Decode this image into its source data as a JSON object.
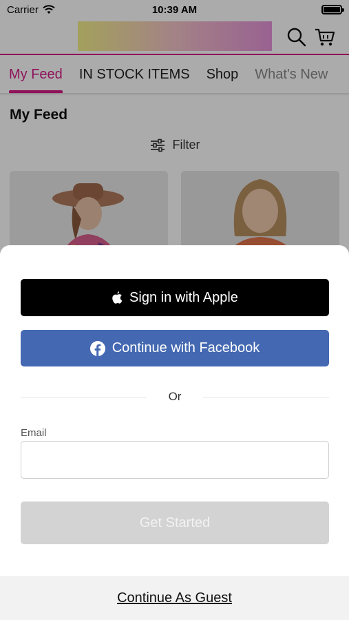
{
  "status_bar": {
    "carrier": "Carrier",
    "time": "10:39 AM"
  },
  "header": {
    "brand_colors": [
      "#f4f08a",
      "#f3c3c8",
      "#e592d9"
    ],
    "accent": "#d51b86",
    "icons": [
      "search-icon",
      "cart-icon"
    ]
  },
  "tabs": [
    {
      "label": "My Feed",
      "active": true
    },
    {
      "label": "IN STOCK ITEMS",
      "active": false
    },
    {
      "label": "Shop",
      "active": false
    },
    {
      "label": "What's New",
      "active": false
    }
  ],
  "feed": {
    "title": "My Feed",
    "filter_label": "Filter"
  },
  "sheet": {
    "apple_label": "Sign in with Apple",
    "facebook_label": "Continue with Facebook",
    "or_label": "Or",
    "email_label": "Email",
    "email_value": "",
    "email_placeholder": "",
    "get_started_label": "Get Started",
    "guest_label": "Continue As Guest",
    "facebook_color": "#4469b2"
  }
}
